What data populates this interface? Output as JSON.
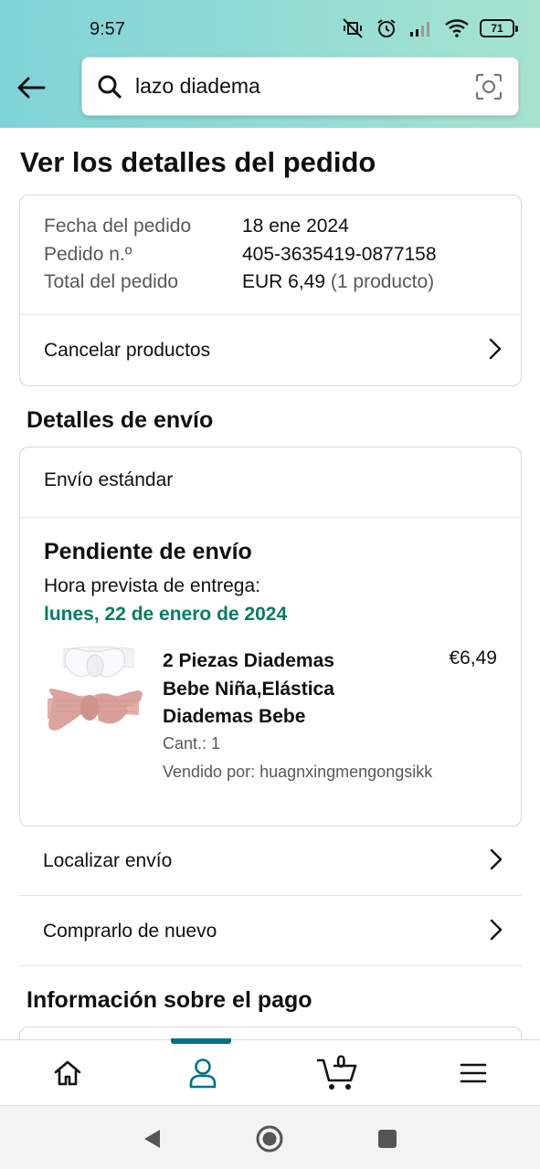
{
  "status_bar": {
    "time": "9:57",
    "battery": "71"
  },
  "search": {
    "query": "lazo diadema"
  },
  "page": {
    "title": "Ver los detalles del pedido"
  },
  "order": {
    "date_label": "Fecha del pedido",
    "date_value": "18 ene 2024",
    "number_label": "Pedido n.º",
    "number_value": "405-3635419-0877158",
    "total_label": "Total del pedido",
    "total_value": "EUR 6,49",
    "total_count": "(1 producto)",
    "cancel_label": "Cancelar productos"
  },
  "shipping": {
    "section_title": "Detalles de envío",
    "type": "Envío estándar",
    "status": "Pendiente de envío",
    "eta_label": "Hora prevista de entrega:",
    "eta_date": "lunes, 22 de enero de 2024",
    "product": {
      "name": "2 Piezas Diademas Bebe Niña,Elástica Diademas Bebe",
      "price": "€6,49",
      "qty": "Cant.: 1",
      "seller": "Vendido por: huagnxingmengongsikk"
    }
  },
  "actions": {
    "track": "Localizar envío",
    "buy_again": "Comprarlo de nuevo"
  },
  "payment": {
    "section_title": "Información sobre el pago"
  },
  "bottom_nav": {
    "cart_count": "0",
    "active": "account"
  },
  "colors": {
    "header_start": "#7fd3d8",
    "header_end": "#a6e3cf",
    "eta_green": "#067d62",
    "active_teal": "#007185"
  }
}
